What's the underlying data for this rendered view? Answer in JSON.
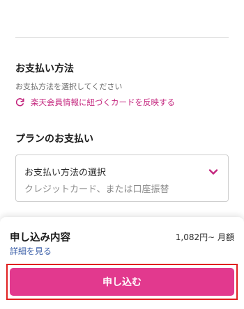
{
  "payment_method": {
    "title": "お支払い方法",
    "subtitle": "お支払方法を選択してください",
    "rakuten_link": "楽天会員情報に紐づくカードを反映する",
    "link_icon": "refresh-icon"
  },
  "plan_payment": {
    "title": "プランのお支払い",
    "select_label": "お支払い方法の選択",
    "select_placeholder": "クレジットカード、または口座振替",
    "chevron_icon": "chevron-down-icon"
  },
  "summary": {
    "title": "申し込み内容",
    "price": "1,082円~ 月額",
    "details_link": "詳細を見る",
    "submit_label": "申し込む"
  },
  "colors": {
    "accent": "#e2398e",
    "link_pink": "#c4267e",
    "link_blue": "#3a5ea8",
    "highlight": "#e02020"
  }
}
